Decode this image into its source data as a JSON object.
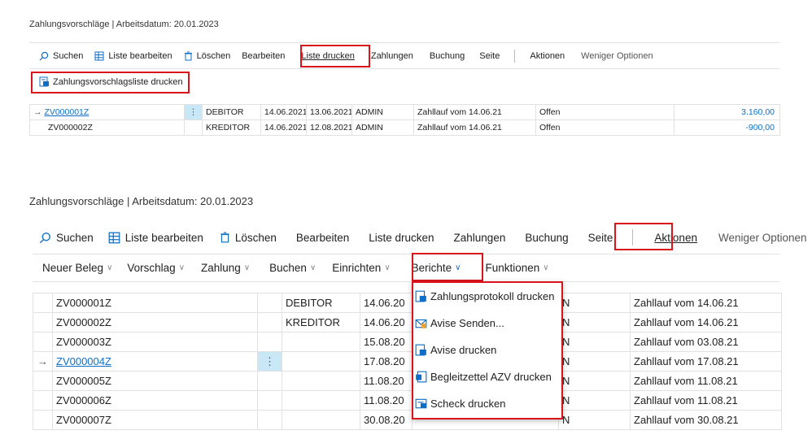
{
  "top": {
    "breadcrumb": "Zahlungsvorschläge | Arbeitsdatum: 20.01.2023",
    "actions": {
      "search": "Suchen",
      "edit_list": "Liste bearbeiten",
      "delete": "Löschen",
      "edit": "Bearbeiten",
      "print_list": "Liste drucken",
      "payments": "Zahlungen",
      "posting": "Buchung",
      "page": "Seite",
      "actions": "Aktionen",
      "fewer_options": "Weniger Optionen"
    },
    "submenu_item": "Zahlungsvorschlagsliste drucken",
    "rows": [
      {
        "no": "ZV000001Z",
        "type": "DEBITOR",
        "date1": "14.06.2021",
        "date2": "13.06.2021",
        "user": "ADMIN",
        "desc": "Zahllauf vom 14.06.21",
        "status": "Offen",
        "amount": "3.160,00"
      },
      {
        "no": "ZV000002Z",
        "type": "KREDITOR",
        "date1": "14.06.2021",
        "date2": "12.08.2021",
        "user": "ADMIN",
        "desc": "Zahllauf vom 14.06.21",
        "status": "Offen",
        "amount": "-900,00"
      }
    ],
    "row_indicator": "→",
    "dots": "⋮"
  },
  "bottom": {
    "breadcrumb": "Zahlungsvorschläge | Arbeitsdatum: 20.01.2023",
    "actions": {
      "search": "Suchen",
      "edit_list": "Liste bearbeiten",
      "delete": "Löschen",
      "edit": "Bearbeiten",
      "print_list": "Liste drucken",
      "payments": "Zahlungen",
      "posting": "Buchung",
      "page": "Seite",
      "actions": "Aktionen",
      "fewer_options": "Weniger Optionen"
    },
    "groups": {
      "new_doc": "Neuer Beleg",
      "proposal": "Vorschlag",
      "payment": "Zahlung",
      "post": "Buchen",
      "setup": "Einrichten",
      "reports": "Berichte",
      "functions": "Funktionen"
    },
    "menu": [
      "Zahlungsprotokoll drucken",
      "Avise Senden...",
      "Avise drucken",
      "Begleitzettel AZV drucken",
      "Scheck drucken"
    ],
    "rows": [
      {
        "no": "ZV000001Z",
        "type": "DEBITOR",
        "date": "14.06.20",
        "s": "N",
        "desc": "Zahllauf vom 14.06.21"
      },
      {
        "no": "ZV000002Z",
        "type": "KREDITOR",
        "date": "14.06.20",
        "s": "N",
        "desc": "Zahllauf vom 14.06.21"
      },
      {
        "no": "ZV000003Z",
        "type": "",
        "date": "15.08.20",
        "s": "N",
        "desc": "Zahllauf vom 03.08.21"
      },
      {
        "no": "ZV000004Z",
        "type": "",
        "date": "17.08.20",
        "s": "N",
        "desc": "Zahllauf vom 17.08.21"
      },
      {
        "no": "ZV000005Z",
        "type": "",
        "date": "11.08.20",
        "s": "N",
        "desc": "Zahllauf vom 11.08.21"
      },
      {
        "no": "ZV000006Z",
        "type": "",
        "date": "11.08.20",
        "s": "N",
        "desc": "Zahllauf vom 11.08.21"
      },
      {
        "no": "ZV000007Z",
        "type": "",
        "date": "30.08.20",
        "s": "N",
        "desc": "Zahllauf vom 30.08.21"
      }
    ],
    "row_indicator": "→",
    "dots": "⋮"
  },
  "colors": {
    "accent": "#0f6fc6",
    "highlight_box": "#d9141b",
    "selected_cell": "#c8e7f7"
  }
}
